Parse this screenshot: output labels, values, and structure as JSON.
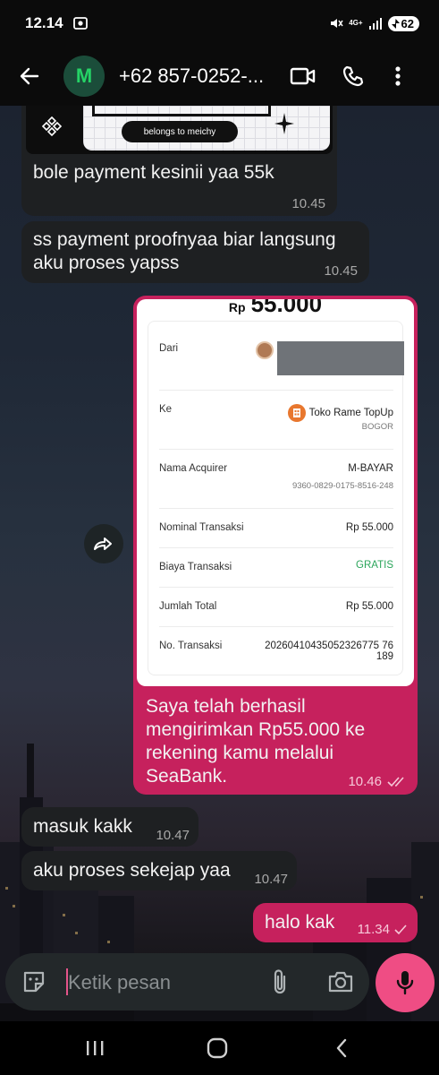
{
  "status_bar": {
    "time": "12.14",
    "network": "4G+",
    "battery": "62"
  },
  "header": {
    "avatar_letter": "M",
    "contact": "+62 857-0252-..."
  },
  "messages": [
    {
      "id": "m1",
      "image_tag": "belongs to meichy",
      "text": "bole payment kesinii yaa 55k",
      "time": "10.45"
    },
    {
      "id": "m2",
      "text": "ss payment proofnyaa biar langsung aku proses yapss",
      "time": "10.45"
    },
    {
      "id": "m3",
      "text": "Saya telah berhasil mengirimkan Rp55.000 ke rekening kamu melalui SeaBank.",
      "time": "10.46"
    },
    {
      "id": "m4",
      "text": "masuk kakk",
      "time": "10.47"
    },
    {
      "id": "m5",
      "text": "aku proses sekejap yaa",
      "time": "10.47"
    },
    {
      "id": "m6",
      "text": "halo kak",
      "time": "11.34"
    }
  ],
  "receipt": {
    "amount_prefix": "Rp",
    "amount": "55.000",
    "from_label": "Dari",
    "to_label": "Ke",
    "to_name": "Toko Rame TopUp",
    "to_city": "BOGOR",
    "acquirer_label": "Nama Acquirer",
    "acquirer": "M-BAYAR",
    "acquirer_id": "9360-0829-0175-8516-248",
    "nominal_label": "Nominal Transaksi",
    "nominal": "Rp 55.000",
    "fee_label": "Biaya Transaksi",
    "fee": "GRATIS",
    "total_label": "Jumlah Total",
    "total": "Rp 55.000",
    "trx_label": "No. Transaksi",
    "trx_no_1": "20260410435052326775 76",
    "trx_no_2": "189"
  },
  "input": {
    "placeholder": "Ketik pesan"
  },
  "colors": {
    "outgoing": "#c6215d",
    "incoming": "#1e2022",
    "mic": "#ef4d84",
    "avatar_text": "#25d366"
  }
}
